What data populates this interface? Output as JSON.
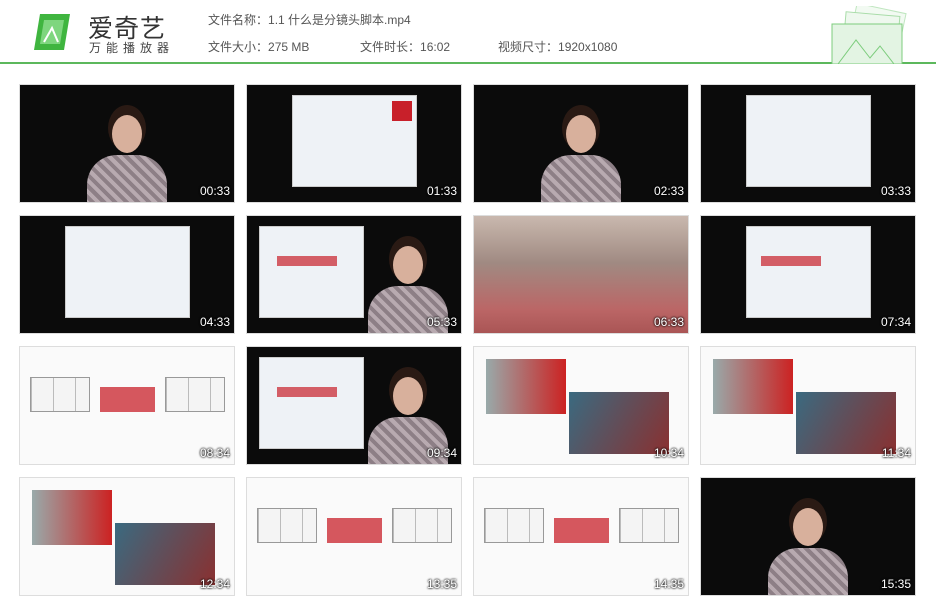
{
  "header": {
    "brand": "爱奇艺",
    "brand_sub": "万能播放器",
    "file_name_label": "文件名称：",
    "file_name": "1.1 什么是分镜头脚本.mp4",
    "file_size_label": "文件大小：",
    "file_size": "275 MB",
    "duration_label": "文件时长：",
    "duration": "16:02",
    "resolution_label": "视频尺寸：",
    "resolution": "1920x1080"
  },
  "colors": {
    "accent": "#5cb85c",
    "logo": "#3fb53f"
  },
  "thumbnails": [
    {
      "time": "00:33",
      "kind": "dark-person"
    },
    {
      "time": "01:33",
      "kind": "dark-slide"
    },
    {
      "time": "02:33",
      "kind": "dark-person"
    },
    {
      "time": "03:33",
      "kind": "dark-slide"
    },
    {
      "time": "04:33",
      "kind": "dark-slide"
    },
    {
      "time": "05:33",
      "kind": "dark-slide-person"
    },
    {
      "time": "06:33",
      "kind": "scene"
    },
    {
      "time": "07:34",
      "kind": "dark-slide"
    },
    {
      "time": "08:34",
      "kind": "light-sketch"
    },
    {
      "time": "09:34",
      "kind": "dark-slide-person"
    },
    {
      "time": "10:34",
      "kind": "light-photo"
    },
    {
      "time": "11:34",
      "kind": "light-photo"
    },
    {
      "time": "12:34",
      "kind": "light-photo"
    },
    {
      "time": "13:35",
      "kind": "light-sketch"
    },
    {
      "time": "14:35",
      "kind": "light-sketch"
    },
    {
      "time": "15:35",
      "kind": "dark-person"
    }
  ]
}
